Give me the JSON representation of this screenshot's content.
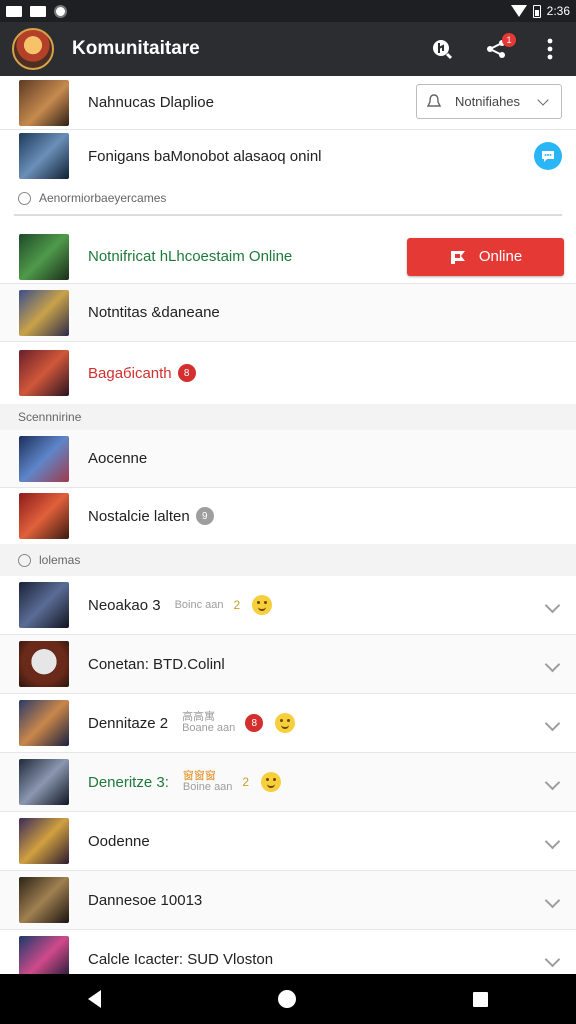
{
  "status_bar": {
    "time": "2:36"
  },
  "appbar": {
    "title": "Komunitaitare",
    "share_badge": "1"
  },
  "rows": [
    {
      "label": "Nahnucas Dlaplioe",
      "notif_label": "Notnifiahes"
    },
    {
      "label": "Fonigans baMonobot alasaoq oninl"
    },
    {
      "section": "Aenormiorbaeyercames"
    },
    {
      "label": "Notnifricat hLhcoestaim Online",
      "button": "Online"
    },
    {
      "label": "Notntitas &daneane"
    },
    {
      "label": "Bagaбicanth",
      "badge": "8"
    },
    {
      "section": "Scennnirine"
    },
    {
      "label": "Aocenne"
    },
    {
      "label": "Nostalcie lalten",
      "badge": "9"
    },
    {
      "section": "lolemas"
    },
    {
      "label": "Neoakao 3",
      "meta_top": "",
      "meta_bottom": "Boinc aan",
      "meta_num": "2"
    },
    {
      "label": "Conetan: BTD.Colinl"
    },
    {
      "label": "Dennitaze 2",
      "meta_top": "高高寓",
      "meta_bottom": "Boane aan",
      "badge": "8"
    },
    {
      "label": "Deneritze 3:",
      "meta_top": "窗窗窗",
      "meta_bottom": "Boine aan",
      "meta_num": "2"
    },
    {
      "label": "Oodenne"
    },
    {
      "label": "Dannesoe 10013"
    },
    {
      "label": "Calcle Icacter: SUD Vloston"
    }
  ],
  "colors": {
    "accent_red": "#e53935",
    "accent_blue": "#29b6f6",
    "green_text": "#1f7a3a"
  }
}
